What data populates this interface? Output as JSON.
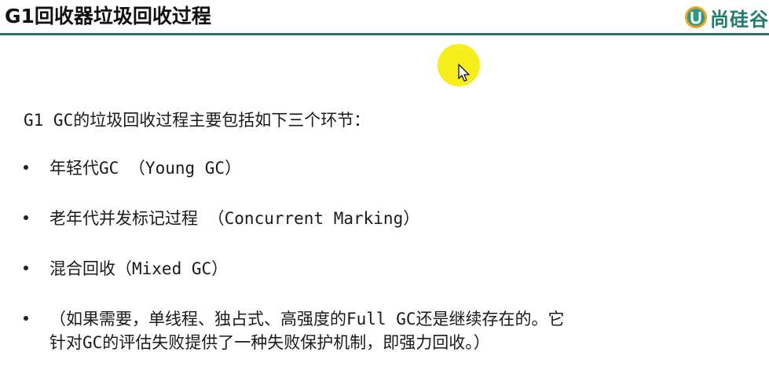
{
  "slide": {
    "title": "G1回收器垃圾回收过程",
    "logo_text": "尚硅谷",
    "logo_icon": "u-logo-icon",
    "accent_color": "#2f6f64",
    "intro": "G1 GC的垃圾回收过程主要包括如下三个环节：",
    "bullets": [
      {
        "line1": "年轻代GC （Young GC）"
      },
      {
        "line1": "老年代并发标记过程 （Concurrent Marking）"
      },
      {
        "line1": "混合回收（Mixed GC）"
      },
      {
        "line1": "（如果需要，单线程、独占式、高强度的Full GC还是继续存在的。它",
        "line2": "针对GC的评估失败提供了一种失败保护机制，即强力回收。）"
      }
    ]
  },
  "cursor": {
    "icon": "mouse-pointer-icon",
    "highlight_color": "#f6ee1a"
  }
}
